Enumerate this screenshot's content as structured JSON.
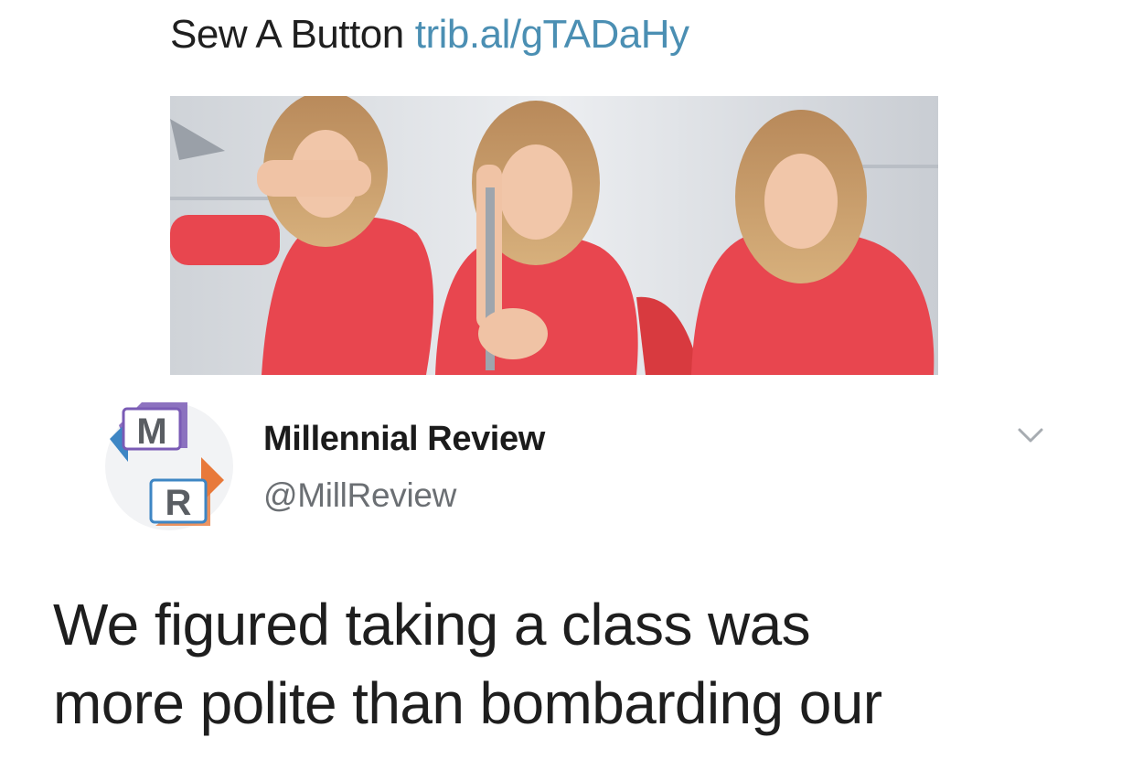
{
  "quoted_tweet": {
    "text": "Sew A Button",
    "link": "trib.al/gTADaHy"
  },
  "media": {
    "colors": {
      "background": "#dfe2e6",
      "shirt": "#e8464f",
      "hair": "#c89a63",
      "skin": "#f1c6a9"
    }
  },
  "tweet": {
    "avatar": {
      "letter_top": "M",
      "letter_bottom": "R",
      "colors": {
        "purple": "#7a5bb5",
        "blue": "#3e86c4",
        "orange": "#e8793a"
      }
    },
    "display_name": "Millennial Review",
    "handle": "@MillReview",
    "menu_icon": "chevron-down-icon",
    "text_lines": [
      "We figured taking a class was",
      "more polite than bombarding our"
    ]
  }
}
